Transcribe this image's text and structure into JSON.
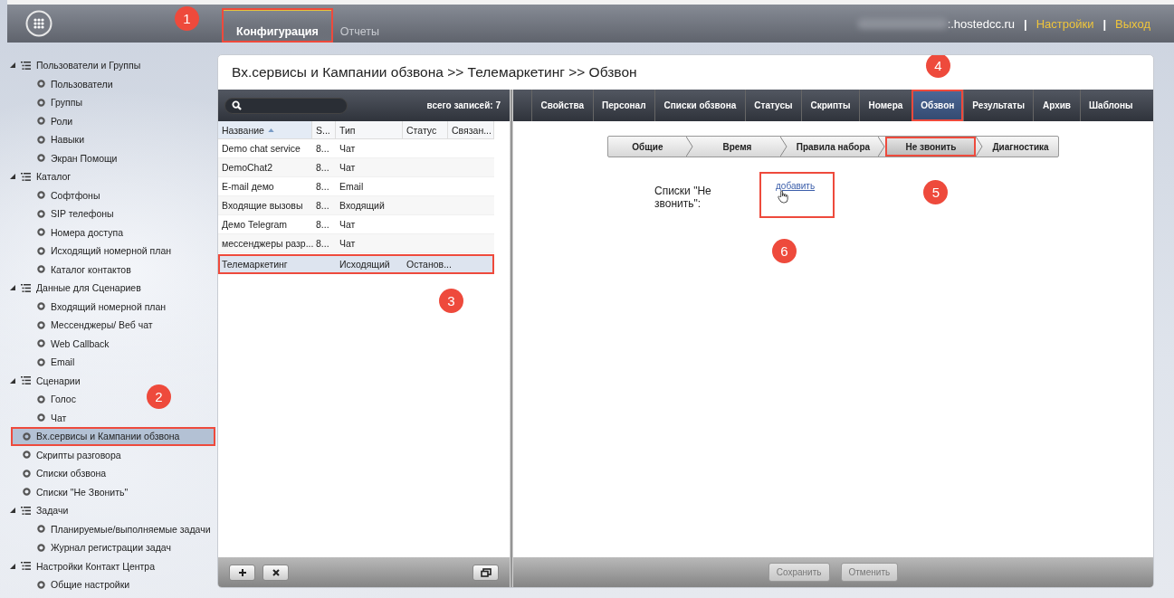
{
  "top_bar": {
    "tabs": [
      {
        "label": "Конфигурация",
        "selected": true,
        "highlighted": true,
        "callout": "1"
      },
      {
        "label": "Отчеты",
        "selected": false,
        "highlighted": false
      }
    ],
    "domain": ":.hostedcc.ru",
    "separator": "|",
    "links": [
      "Настройки",
      "Выход"
    ]
  },
  "sidebar": {
    "items": [
      {
        "label": "Пользователи и Группы",
        "expanded": true,
        "children": [
          {
            "label": "Пользователи"
          },
          {
            "label": "Группы"
          },
          {
            "label": "Роли"
          },
          {
            "label": "Навыки"
          },
          {
            "label": "Экран Помощи"
          }
        ]
      },
      {
        "label": "Каталог",
        "expanded": true,
        "children": [
          {
            "label": "Софтфоны"
          },
          {
            "label": "SIP телефоны"
          },
          {
            "label": "Номера доступа"
          },
          {
            "label": "Исходящий номерной план"
          },
          {
            "label": "Каталог контактов"
          }
        ]
      },
      {
        "label": "Данные для Сценариев",
        "expanded": true,
        "children": [
          {
            "label": "Входящий номерной план"
          },
          {
            "label": "Мессенджеры/ Веб чат"
          },
          {
            "label": "Web Callback"
          },
          {
            "label": "Email"
          }
        ]
      },
      {
        "label": "Сценарии",
        "expanded": true,
        "children": [
          {
            "label": "Голос"
          },
          {
            "label": "Чат"
          }
        ]
      },
      {
        "label": "Вх.сервисы и Кампании обзвона",
        "selected": true,
        "highlighted": true,
        "callout": "2"
      },
      {
        "label": "Скрипты разговора",
        "selected": false
      },
      {
        "label": "Списки обзвона",
        "selected": false
      },
      {
        "label": "Списки \"Не Звонить\"",
        "selected": false
      },
      {
        "label": "Задачи",
        "expanded": true,
        "children": [
          {
            "label": "Планируемые/выполняемые задачи"
          },
          {
            "label": "Журнал регистрации задач"
          }
        ]
      },
      {
        "label": "Настройки Контакт Центра",
        "expanded": true,
        "children": [
          {
            "label": "Общие настройки"
          }
        ]
      }
    ]
  },
  "panel": {
    "title": "Вх.сервисы и Кампании обзвона >> Телемаркетинг >> Обзвон",
    "list": {
      "count": "всего записей: 7",
      "columns": [
        {
          "label": "Название",
          "sorted": true
        },
        {
          "label": "S...",
          "sorted": false
        },
        {
          "label": "Тип",
          "sorted": false
        },
        {
          "label": "Статус",
          "sorted": false
        },
        {
          "label": "Связан...",
          "sorted": false
        }
      ],
      "rows": [
        {
          "cells": [
            "Demo chat service",
            "8...",
            "Чат",
            "",
            ""
          ],
          "selected": false
        },
        {
          "cells": [
            "DemoChat2",
            "8...",
            "Чат",
            "",
            ""
          ],
          "selected": false
        },
        {
          "cells": [
            "E-mail демо",
            "8...",
            "Email",
            "",
            ""
          ],
          "selected": false
        },
        {
          "cells": [
            "Входящие вызовы",
            "8...",
            "Входящий",
            "",
            ""
          ],
          "selected": false
        },
        {
          "cells": [
            "Демо Telegram",
            "8...",
            "Чат",
            "",
            ""
          ],
          "selected": false
        },
        {
          "cells": [
            "мессенджеры разр...",
            "8...",
            "Чат",
            "",
            ""
          ],
          "selected": false
        },
        {
          "cells": [
            "Телемаркетинг",
            "",
            "Исходящий",
            "Останов...",
            ""
          ],
          "selected": true,
          "highlighted": true,
          "callout": "3"
        }
      ]
    },
    "tabs": [
      {
        "label": "Свойства",
        "selected": false
      },
      {
        "label": "Персонал",
        "selected": false
      },
      {
        "label": "Списки обзвона",
        "selected": false
      },
      {
        "label": "Статусы",
        "selected": false
      },
      {
        "label": "Скрипты",
        "selected": false
      },
      {
        "label": "Номера",
        "selected": false
      },
      {
        "label": "Обзвон",
        "selected": true,
        "highlighted": true,
        "callout": "4"
      },
      {
        "label": "Результаты",
        "selected": false
      },
      {
        "label": "Архив",
        "selected": false
      },
      {
        "label": "Шаблоны",
        "selected": false
      }
    ],
    "steps": [
      {
        "label": "Общие",
        "selected": false
      },
      {
        "label": "Время",
        "selected": false
      },
      {
        "label": "Правила набора",
        "selected": false
      },
      {
        "label": "Не звонить",
        "selected": true,
        "highlighted": true,
        "callout": "5"
      },
      {
        "label": "Диагностика",
        "selected": false
      }
    ],
    "form": {
      "label": "Списки \"Не звонить\":",
      "link": "добавить",
      "highlighted": true,
      "callout": "6"
    },
    "buttons": [
      {
        "label": "Сохранить",
        "disabled": true
      },
      {
        "label": "Отменить",
        "disabled": true
      }
    ]
  }
}
